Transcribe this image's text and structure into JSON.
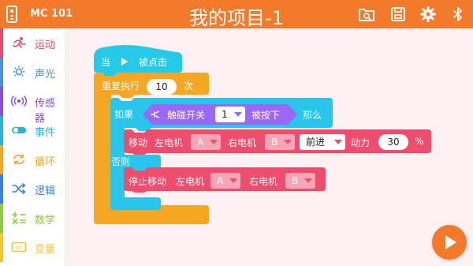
{
  "header": {
    "device_name": "MC 101",
    "title": "我的项目-1",
    "buttons": [
      "folder-search-icon",
      "save-icon",
      "gear-icon",
      "bluetooth-icon"
    ]
  },
  "sidebar": {
    "items": [
      {
        "label": "运动",
        "icon": "running-figure-icon",
        "color": "#e84c6b"
      },
      {
        "label": "声光",
        "icon": "light-sound-icon",
        "color": "#4a90e2"
      },
      {
        "label": "传感器",
        "icon": "sensor-waves-icon",
        "color": "#8a4be0"
      },
      {
        "label": "事件",
        "icon": "toggle-icon",
        "color": "#26b5d0"
      },
      {
        "label": "循环",
        "icon": "loop-arrows-icon",
        "color": "#f5a623"
      },
      {
        "label": "逻辑",
        "icon": "shuffle-icon",
        "color": "#3a7fe8"
      },
      {
        "label": "数学",
        "icon": "math-operators-icon",
        "color": "#8ccc3c"
      },
      {
        "label": "变量",
        "icon": "variable-icon",
        "color": "#f5c52b"
      }
    ]
  },
  "blocks": {
    "event": {
      "prefix": "当",
      "suffix": "被点击"
    },
    "repeat": {
      "label": "重复执行",
      "count": "10",
      "unit": "次"
    },
    "if_block": {
      "if_label": "如果",
      "condition": {
        "label": "触碰开关",
        "port": "1",
        "state": "被按下"
      },
      "then_label": "那么",
      "else_label": "否则"
    },
    "move": {
      "label": "移动",
      "left_motor": "左电机",
      "left_port": "A",
      "right_motor": "右电机",
      "right_port": "B",
      "direction": "前进",
      "power_label": "动力",
      "power": "30",
      "unit": "%"
    },
    "stop": {
      "label": "停止移动",
      "left_motor": "左电机",
      "left_port": "A",
      "right_motor": "右电机",
      "right_port": "B"
    }
  },
  "colors": {
    "topbar": "#f47a2b",
    "event_block": "#26c9e6",
    "loop_block": "#f5a623",
    "logic_block": "#29c5ea",
    "condition_block": "#9a68f5",
    "motion_block": "#ee4d6d",
    "canvas": "#fdf1f4"
  }
}
